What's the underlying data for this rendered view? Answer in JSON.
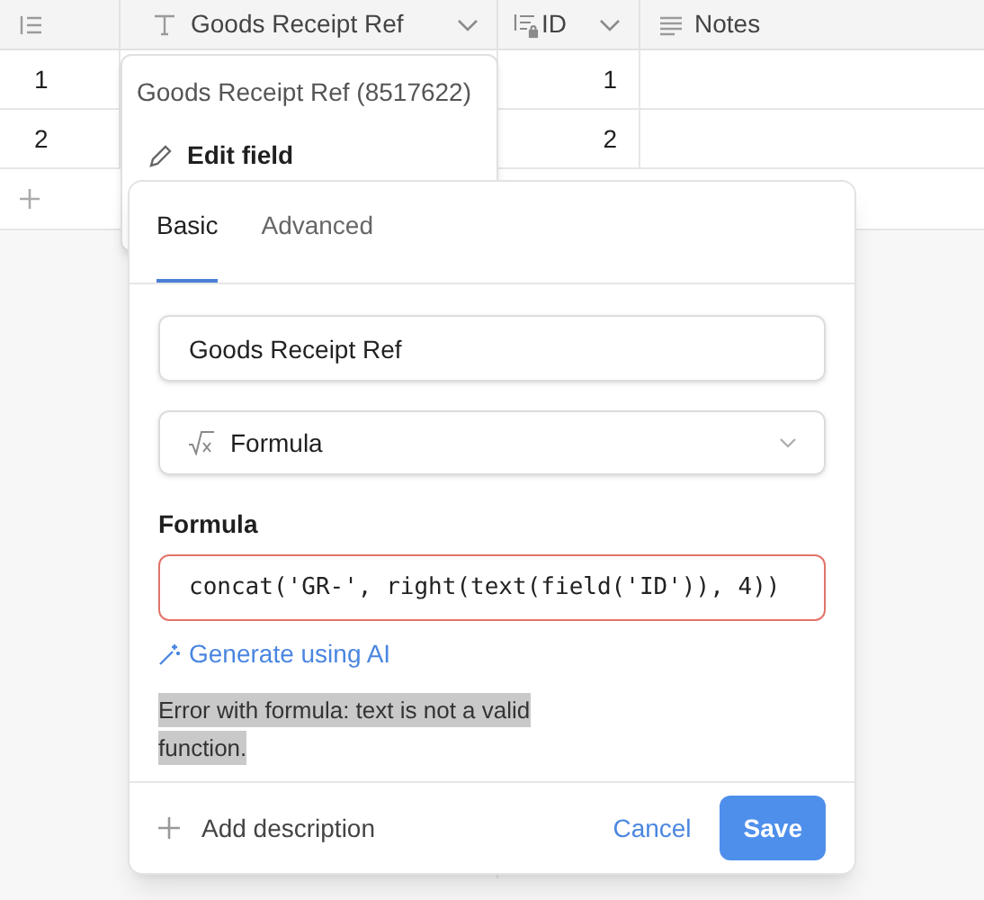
{
  "table": {
    "columns": [
      {
        "kind": "row_number"
      },
      {
        "kind": "text",
        "label": "Goods Receipt Ref"
      },
      {
        "kind": "autonumber",
        "label": "ID"
      },
      {
        "kind": "long_text",
        "label": "Notes"
      }
    ],
    "rows": [
      {
        "number": "1",
        "id": "1"
      },
      {
        "number": "2",
        "id": "2"
      }
    ]
  },
  "context_menu": {
    "title": "Goods Receipt Ref (8517622)",
    "items": [
      {
        "label": "Edit field"
      }
    ]
  },
  "dialog": {
    "tabs": [
      {
        "label": "Basic",
        "selected": true
      },
      {
        "label": "Advanced",
        "selected": false
      }
    ],
    "name_field": {
      "value": "Goods Receipt Ref"
    },
    "type_select": {
      "value": "Formula"
    },
    "formula": {
      "label": "Formula",
      "value": "concat('GR-', right(text(field('ID')), 4))",
      "error": true
    },
    "generate_link": "Generate using AI",
    "error_message": "Error with formula: text is not a valid function.",
    "footer": {
      "add_description": "Add description",
      "cancel": "Cancel",
      "save": "Save"
    }
  }
}
